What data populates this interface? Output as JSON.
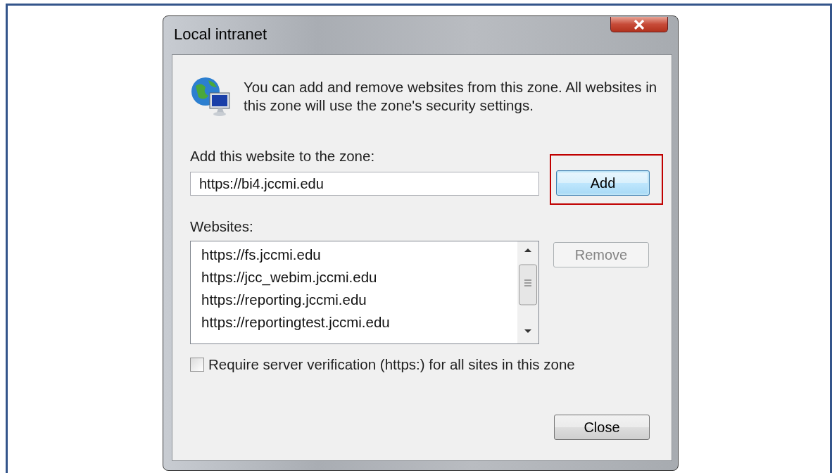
{
  "window": {
    "title": "Local intranet"
  },
  "description": "You can add and remove websites from this zone. All websites in this zone will use the zone's security settings.",
  "add_field": {
    "label": "Add this website to the zone:",
    "value": "https://bi4.jccmi.edu"
  },
  "add_button": {
    "label": "Add",
    "highlighted": true
  },
  "websites": {
    "label": "Websites:",
    "items": [
      {
        "text": "https://fs.jccmi.edu",
        "selected": false
      },
      {
        "text": "https://jcc_webim.jccmi.edu",
        "selected": false
      },
      {
        "text": "https://reporting.jccmi.edu",
        "selected": false
      },
      {
        "text": "https://reportingtest.jccmi.edu",
        "selected": false
      }
    ]
  },
  "remove_button": {
    "label": "Remove",
    "disabled": true
  },
  "require_verification": {
    "label": "Require server verification (https:) for all sites in this zone",
    "checked": false
  },
  "close_button": {
    "label": "Close"
  }
}
